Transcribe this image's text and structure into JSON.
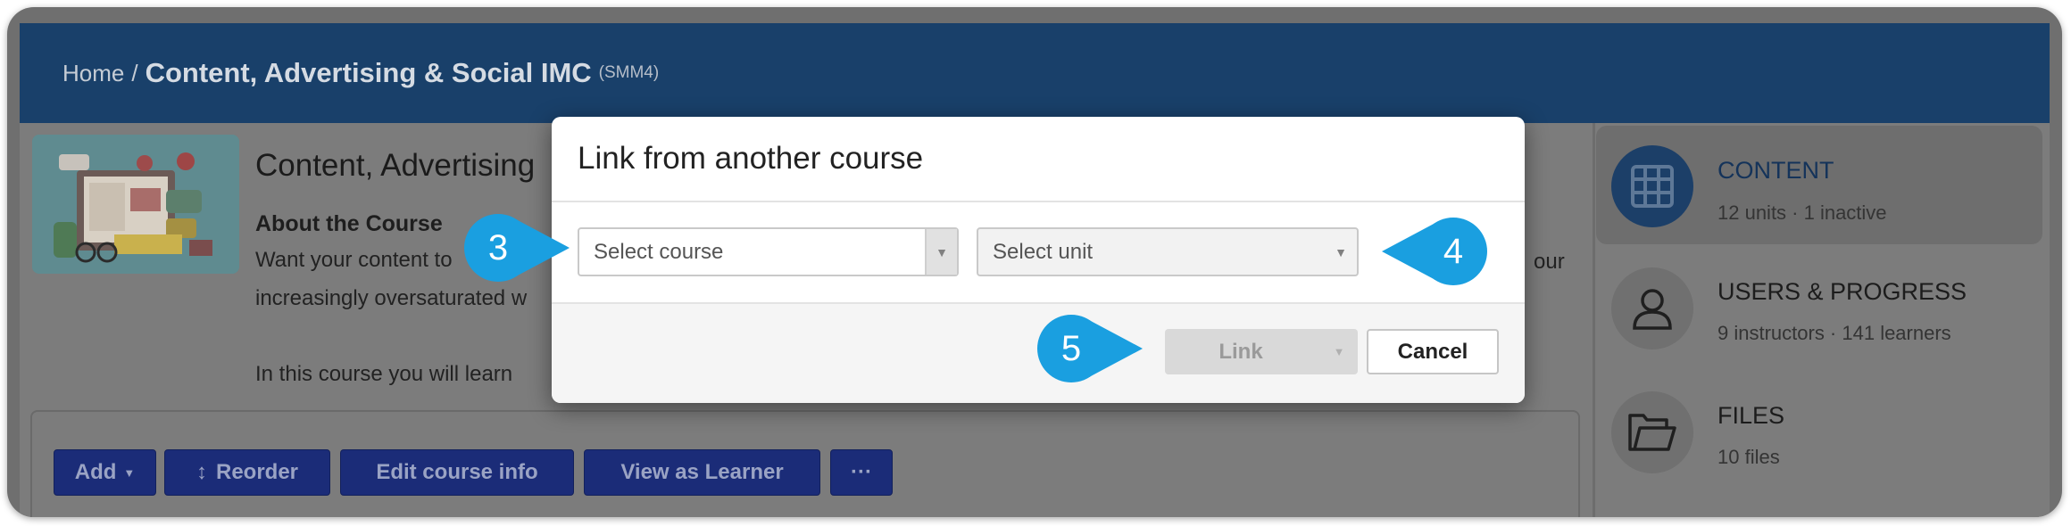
{
  "header": {
    "home": "Home",
    "separator": "/",
    "title": "Content, Advertising & Social IMC",
    "code": "(SMM4)"
  },
  "course": {
    "title": "Content, Advertising",
    "about_title": "About the Course",
    "lines": [
      "Want your content to",
      "increasingly oversaturated w",
      "In this course you will learn"
    ],
    "right_fragment": "our"
  },
  "toolbar": {
    "add": "Add",
    "reorder": "Reorder",
    "edit_info": "Edit course info",
    "view_as_learner": "View as Learner",
    "more": "···"
  },
  "sidebar": {
    "items": [
      {
        "label": "CONTENT",
        "sub": "12 units · 1 inactive",
        "icon": "grid-icon",
        "active": true
      },
      {
        "label": "USERS & PROGRESS",
        "sub": "9 instructors · 141 learners",
        "icon": "user-icon",
        "active": false
      },
      {
        "label": "FILES",
        "sub": "10 files",
        "icon": "folder-icon",
        "active": false
      }
    ]
  },
  "modal": {
    "title": "Link from another course",
    "course_select_placeholder": "Select course",
    "unit_select_placeholder": "Select unit",
    "link_label": "Link",
    "cancel_label": "Cancel"
  },
  "callouts": [
    "3",
    "4",
    "5"
  ],
  "colors": {
    "header_bg": "#19406a",
    "callout": "#1a9fe0",
    "button_bg": "#1b2c78"
  }
}
